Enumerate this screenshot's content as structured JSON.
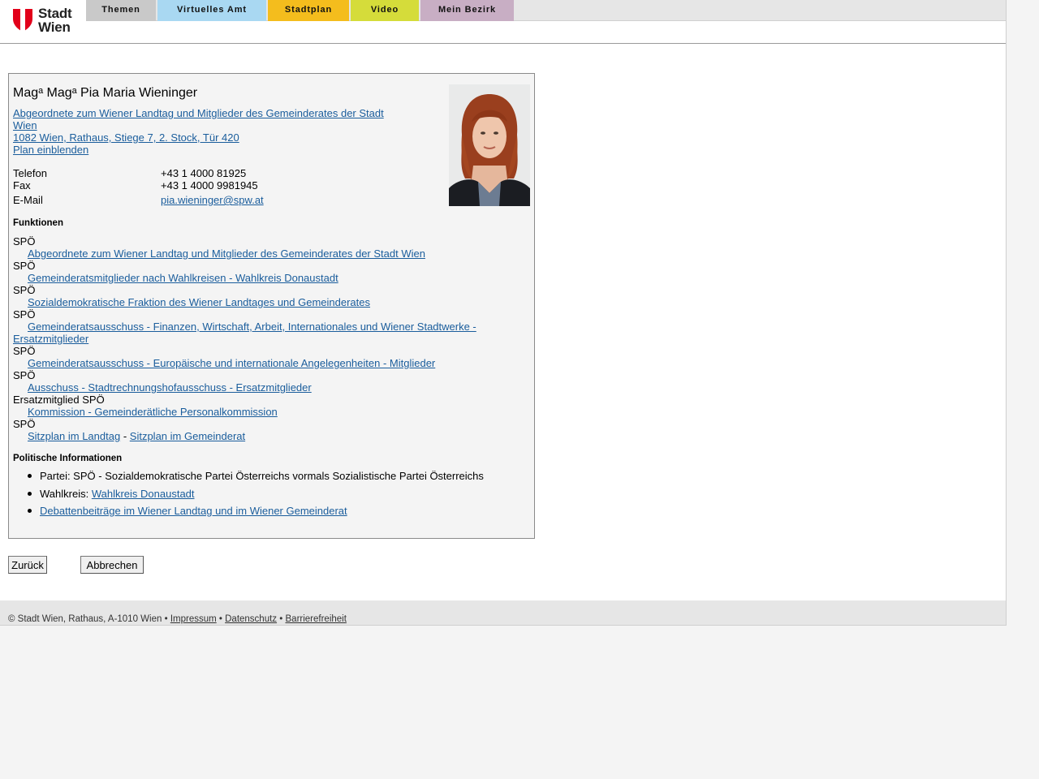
{
  "logo": {
    "line1": "Stadt",
    "line2": "Wien"
  },
  "nav": [
    "Themen",
    "Virtuelles Amt",
    "Stadtplan",
    "Video",
    "Mein Bezirk"
  ],
  "person": {
    "name": "Magᵃ Magᵃ Pia Maria Wieninger",
    "role_link_line1": "Abgeordnete zum Wiener Landtag und Mitglieder des Gemeinderates der Stadt",
    "role_link_line2": "Wien",
    "address": "1082 Wien, Rathaus, Stiege 7, 2. Stock, Tür 420",
    "plan_link": "Plan einblenden",
    "contact": [
      {
        "label": "Telefon",
        "value": "+43 1 4000 81925"
      },
      {
        "label": "Fax",
        "value": "+43 1 4000 9981945"
      },
      {
        "label": "E-Mail",
        "value": "pia.wieninger@spw.at"
      }
    ]
  },
  "functions": {
    "heading": "Funktionen",
    "items": [
      {
        "party": "SPÖ",
        "link": "Abgeordnete zum Wiener Landtag und Mitglieder des Gemeinderates der Stadt Wien"
      },
      {
        "party": "SPÖ",
        "link": "Gemeinderatsmitglieder nach Wahlkreisen - Wahlkreis Donaustadt"
      },
      {
        "party": "SPÖ",
        "link": "Sozialdemokratische Fraktion des Wiener Landtages und Gemeinderates"
      },
      {
        "party": "SPÖ",
        "link_line1": "Gemeinderatsausschuss - Finanzen, Wirtschaft, Arbeit, Internationales und Wiener Stadtwerke -",
        "link_line2": "Ersatzmitglieder"
      },
      {
        "party": "SPÖ",
        "link": "Gemeinderatsausschuss - Europäische und internationale Angelegenheiten - Mitglieder"
      },
      {
        "party": "SPÖ",
        "link": "Ausschuss - Stadtrechnungshofausschuss - Ersatzmitglieder"
      },
      {
        "party": "Ersatzmitglied SPÖ",
        "link": "Kommission - Gemeinderätliche Personalkommission"
      },
      {
        "party": "SPÖ",
        "link_a": "Sitzplan im Landtag",
        "separator": "-",
        "link_b": "Sitzplan im Gemeinderat"
      }
    ]
  },
  "political": {
    "heading": "Politische Informationen",
    "party": "Partei: SPÖ - Sozialdemokratische Partei Österreichs vormals Sozialistische Partei Österreichs",
    "district_label": "Wahlkreis:",
    "district_link": "Wahlkreis Donaustadt",
    "debates_link": "Debattenbeiträge im Wiener Landtag und im Wiener Gemeinderat"
  },
  "buttons": {
    "back": "Zurück",
    "cancel": "Abbrechen"
  },
  "footer": {
    "copyright": "© Stadt Wien, Rathaus, A-1010 Wien",
    "sep": "•",
    "impressum": "Impressum",
    "datenschutz": "Datenschutz",
    "barrierefreiheit": "Barrierefreiheit"
  }
}
